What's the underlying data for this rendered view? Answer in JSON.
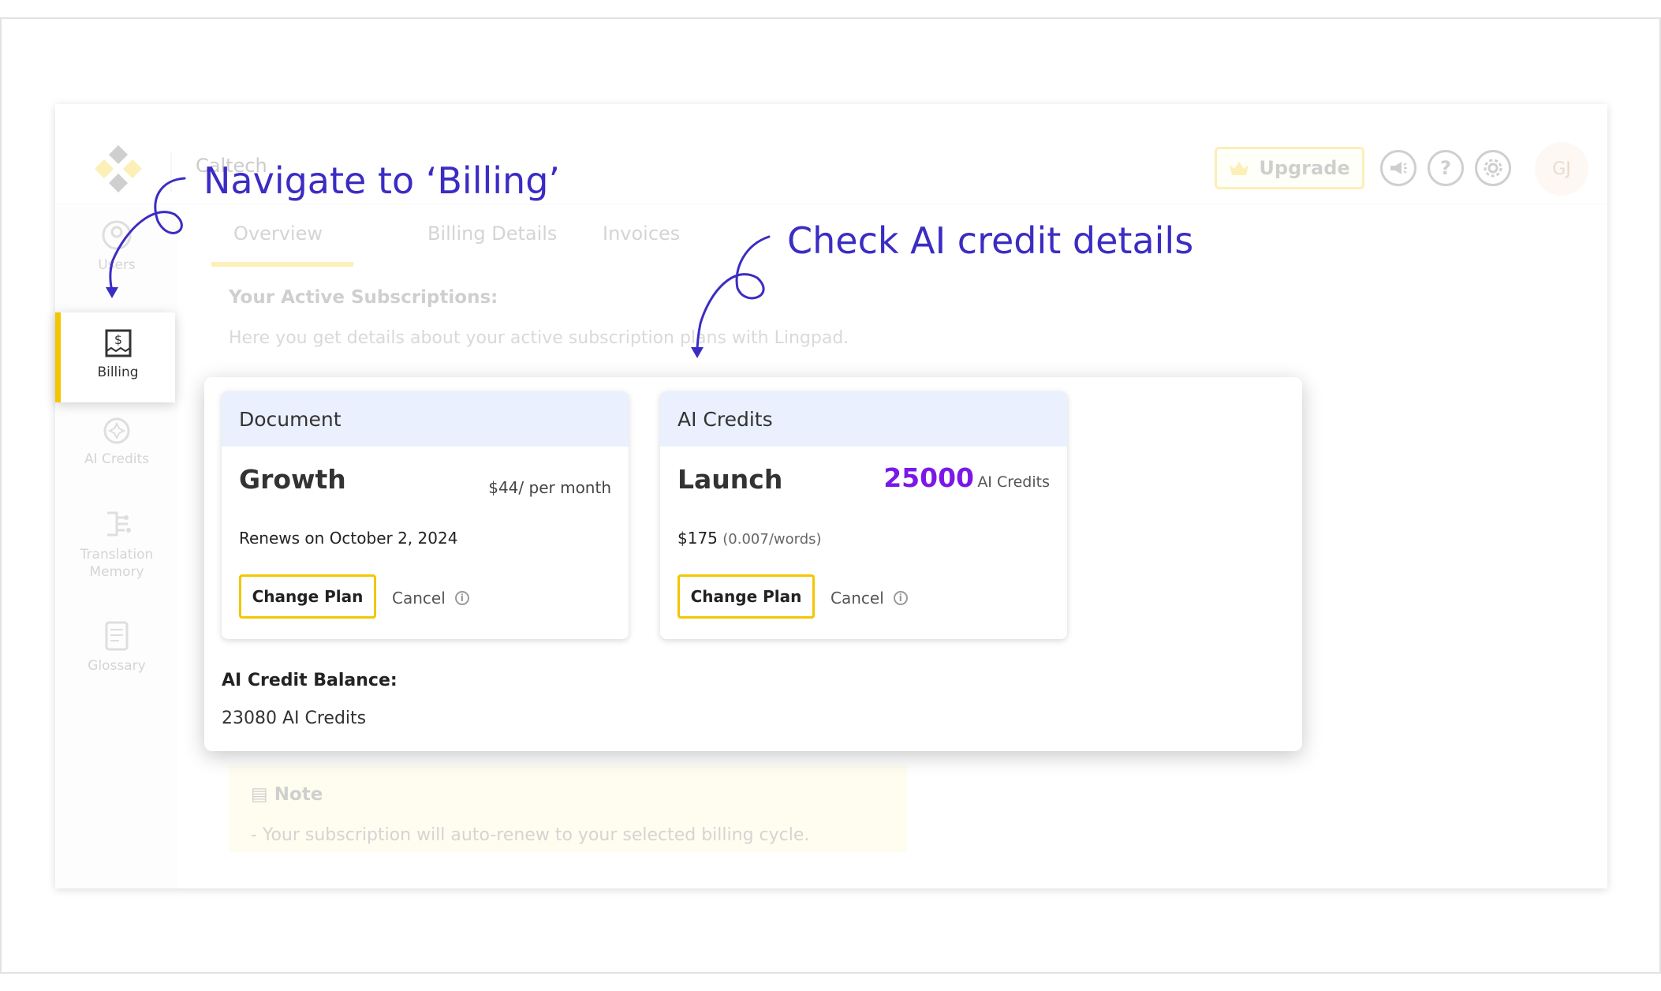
{
  "app": {
    "brand": "Caltech",
    "upgrade_label": "Upgrade",
    "avatar_initials": "GJ",
    "accent": "#f3c600",
    "annotation_color": "#3b2cc3"
  },
  "sidebar": {
    "items": [
      {
        "label": "Users",
        "icon": "users-icon"
      },
      {
        "label": "Billing",
        "icon": "billing-icon"
      },
      {
        "label": "AI Credits",
        "icon": "ai-credits-icon"
      },
      {
        "label": "Translation Memory",
        "icon": "translation-memory-icon"
      },
      {
        "label": "Glossary",
        "icon": "glossary-icon"
      }
    ]
  },
  "tabs": [
    "Overview",
    "Billing Details",
    "Invoices"
  ],
  "subscriptions": {
    "title": "Your Active Subscriptions:",
    "description": "Here you get details about your active subscription plans with Lingpad."
  },
  "cards": {
    "document": {
      "header": "Document",
      "plan": "Growth",
      "price": "$44/ per month",
      "renews": "Renews on October 2, 2024",
      "change_label": "Change Plan",
      "cancel_label": "Cancel"
    },
    "ai_credits": {
      "header": "AI Credits",
      "plan": "Launch",
      "credits": "25000",
      "credits_unit": "AI Credits",
      "price": "$175",
      "price_detail": "(0.007/words)",
      "change_label": "Change Plan",
      "cancel_label": "Cancel",
      "credits_color": "#7b18e8"
    }
  },
  "balance": {
    "label": "AI Credit Balance:",
    "value": "23080 AI Credits"
  },
  "note": {
    "title": "Note",
    "text": "- Your subscription will auto-renew to your selected billing cycle."
  },
  "annotations": {
    "navigate": "Navigate to ‘Billing’",
    "check": "Check AI credit details"
  }
}
